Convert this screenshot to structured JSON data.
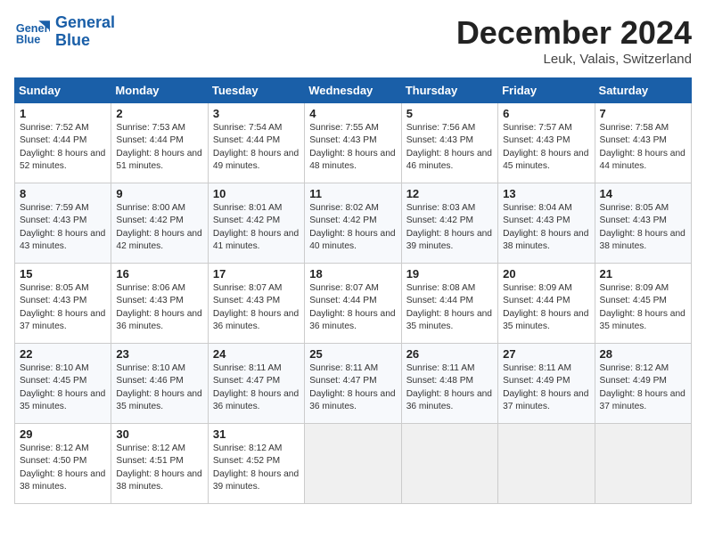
{
  "header": {
    "logo_line1": "General",
    "logo_line2": "Blue",
    "month": "December 2024",
    "location": "Leuk, Valais, Switzerland"
  },
  "columns": [
    "Sunday",
    "Monday",
    "Tuesday",
    "Wednesday",
    "Thursday",
    "Friday",
    "Saturday"
  ],
  "weeks": [
    [
      {
        "day": "1",
        "sr": "7:52 AM",
        "ss": "4:44 PM",
        "dl": "8 hours and 52 minutes."
      },
      {
        "day": "2",
        "sr": "7:53 AM",
        "ss": "4:44 PM",
        "dl": "8 hours and 51 minutes."
      },
      {
        "day": "3",
        "sr": "7:54 AM",
        "ss": "4:44 PM",
        "dl": "8 hours and 49 minutes."
      },
      {
        "day": "4",
        "sr": "7:55 AM",
        "ss": "4:43 PM",
        "dl": "8 hours and 48 minutes."
      },
      {
        "day": "5",
        "sr": "7:56 AM",
        "ss": "4:43 PM",
        "dl": "8 hours and 46 minutes."
      },
      {
        "day": "6",
        "sr": "7:57 AM",
        "ss": "4:43 PM",
        "dl": "8 hours and 45 minutes."
      },
      {
        "day": "7",
        "sr": "7:58 AM",
        "ss": "4:43 PM",
        "dl": "8 hours and 44 minutes."
      }
    ],
    [
      {
        "day": "8",
        "sr": "7:59 AM",
        "ss": "4:43 PM",
        "dl": "8 hours and 43 minutes."
      },
      {
        "day": "9",
        "sr": "8:00 AM",
        "ss": "4:42 PM",
        "dl": "8 hours and 42 minutes."
      },
      {
        "day": "10",
        "sr": "8:01 AM",
        "ss": "4:42 PM",
        "dl": "8 hours and 41 minutes."
      },
      {
        "day": "11",
        "sr": "8:02 AM",
        "ss": "4:42 PM",
        "dl": "8 hours and 40 minutes."
      },
      {
        "day": "12",
        "sr": "8:03 AM",
        "ss": "4:42 PM",
        "dl": "8 hours and 39 minutes."
      },
      {
        "day": "13",
        "sr": "8:04 AM",
        "ss": "4:43 PM",
        "dl": "8 hours and 38 minutes."
      },
      {
        "day": "14",
        "sr": "8:05 AM",
        "ss": "4:43 PM",
        "dl": "8 hours and 38 minutes."
      }
    ],
    [
      {
        "day": "15",
        "sr": "8:05 AM",
        "ss": "4:43 PM",
        "dl": "8 hours and 37 minutes."
      },
      {
        "day": "16",
        "sr": "8:06 AM",
        "ss": "4:43 PM",
        "dl": "8 hours and 36 minutes."
      },
      {
        "day": "17",
        "sr": "8:07 AM",
        "ss": "4:43 PM",
        "dl": "8 hours and 36 minutes."
      },
      {
        "day": "18",
        "sr": "8:07 AM",
        "ss": "4:44 PM",
        "dl": "8 hours and 36 minutes."
      },
      {
        "day": "19",
        "sr": "8:08 AM",
        "ss": "4:44 PM",
        "dl": "8 hours and 35 minutes."
      },
      {
        "day": "20",
        "sr": "8:09 AM",
        "ss": "4:44 PM",
        "dl": "8 hours and 35 minutes."
      },
      {
        "day": "21",
        "sr": "8:09 AM",
        "ss": "4:45 PM",
        "dl": "8 hours and 35 minutes."
      }
    ],
    [
      {
        "day": "22",
        "sr": "8:10 AM",
        "ss": "4:45 PM",
        "dl": "8 hours and 35 minutes."
      },
      {
        "day": "23",
        "sr": "8:10 AM",
        "ss": "4:46 PM",
        "dl": "8 hours and 35 minutes."
      },
      {
        "day": "24",
        "sr": "8:11 AM",
        "ss": "4:47 PM",
        "dl": "8 hours and 36 minutes."
      },
      {
        "day": "25",
        "sr": "8:11 AM",
        "ss": "4:47 PM",
        "dl": "8 hours and 36 minutes."
      },
      {
        "day": "26",
        "sr": "8:11 AM",
        "ss": "4:48 PM",
        "dl": "8 hours and 36 minutes."
      },
      {
        "day": "27",
        "sr": "8:11 AM",
        "ss": "4:49 PM",
        "dl": "8 hours and 37 minutes."
      },
      {
        "day": "28",
        "sr": "8:12 AM",
        "ss": "4:49 PM",
        "dl": "8 hours and 37 minutes."
      }
    ],
    [
      {
        "day": "29",
        "sr": "8:12 AM",
        "ss": "4:50 PM",
        "dl": "8 hours and 38 minutes."
      },
      {
        "day": "30",
        "sr": "8:12 AM",
        "ss": "4:51 PM",
        "dl": "8 hours and 38 minutes."
      },
      {
        "day": "31",
        "sr": "8:12 AM",
        "ss": "4:52 PM",
        "dl": "8 hours and 39 minutes."
      },
      null,
      null,
      null,
      null
    ]
  ]
}
